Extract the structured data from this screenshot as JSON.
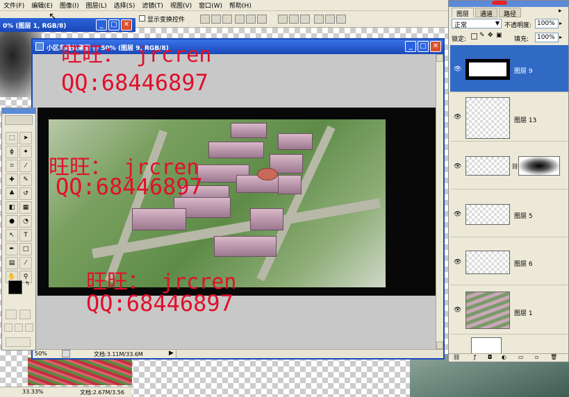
{
  "menubar": {
    "items": [
      "文件(F)",
      "编辑(E)",
      "图像(I)",
      "图层(L)",
      "选择(S)",
      "滤镜(T)",
      "视图(V)",
      "窗口(W)",
      "帮助(H)"
    ]
  },
  "options": {
    "show_transform_label": "显示变换控件"
  },
  "back_window": {
    "title": "0% (图层 1, RGB/8)",
    "zoom": "33.33%",
    "doc_info": "文档:2.67M/3.56"
  },
  "main_window": {
    "title": "小区鸟瞰效果图 @ 50% (图层 9, RGB/8)",
    "zoom": "50%",
    "doc_info": "文档:3.11M/33.6M"
  },
  "watermarks": [
    {
      "line1": "旺旺： jrcren",
      "line2": "QQ:68446897"
    },
    {
      "line1": "旺旺： jrcren",
      "line2": "QQ:68446897"
    },
    {
      "line1": "旺旺： jrcren",
      "line2": "QQ:68446897"
    }
  ],
  "layers_panel": {
    "tabs": [
      "图层",
      "通道",
      "路径"
    ],
    "blend_mode": "正常",
    "opacity_label": "不透明度:",
    "opacity_value": "100%",
    "lock_label": "锁定:",
    "fill_label": "填充:",
    "fill_value": "100%",
    "layers": [
      {
        "name": "图层 9",
        "selected": true
      },
      {
        "name": "图层 13",
        "selected": false
      },
      {
        "name": "",
        "selected": false
      },
      {
        "name": "图层 5",
        "selected": false
      },
      {
        "name": "图层 6",
        "selected": false
      },
      {
        "name": "图层 1",
        "selected": false
      }
    ]
  },
  "colors": {
    "watermark": "#e0102a",
    "title_blue": "#1a48b8",
    "selected_layer": "#316ac5"
  }
}
